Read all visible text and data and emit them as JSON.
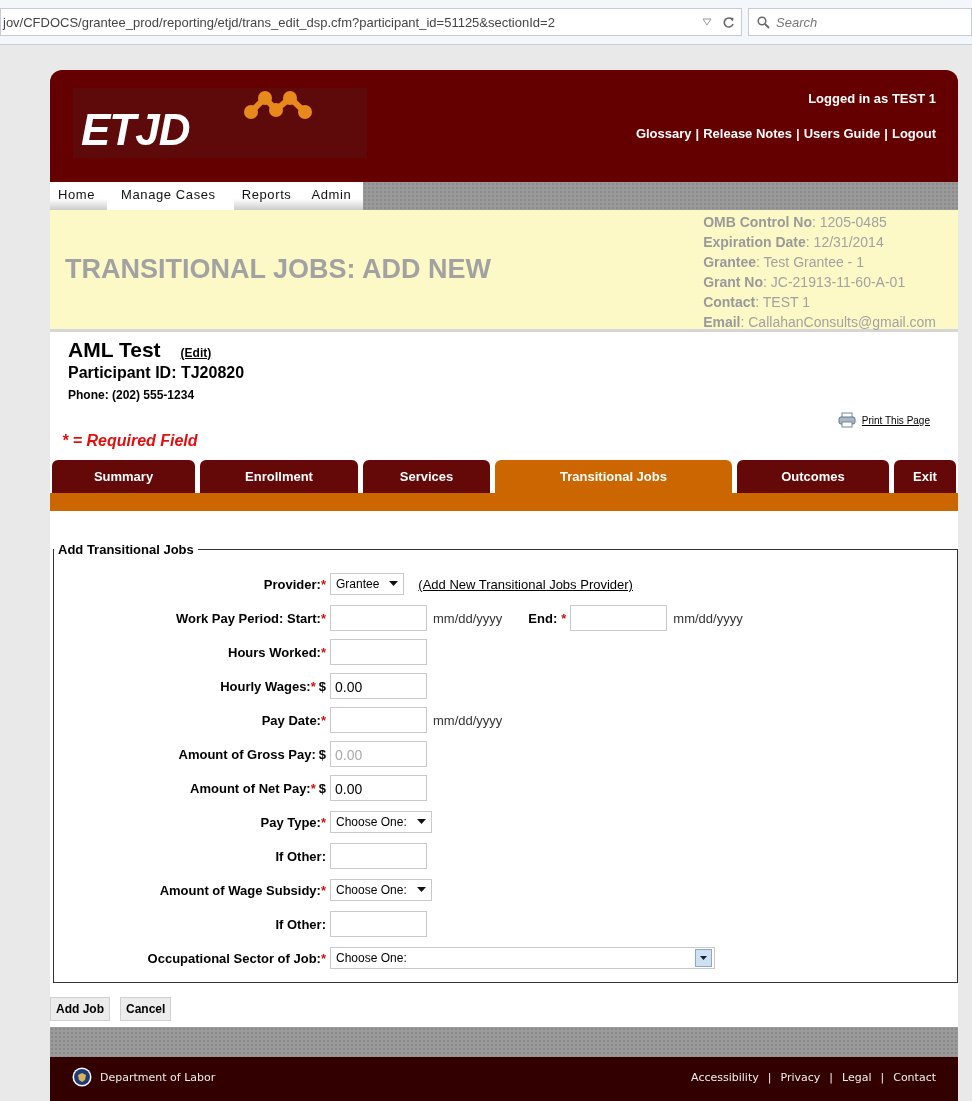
{
  "browser": {
    "url": "jov/CFDOCS/grantee_prod/reporting/etjd/trans_edit_dsp.cfm?participant_id=51125&sectionId=2",
    "search_placeholder": "Search"
  },
  "header": {
    "logo": "ETJD",
    "logged_in": "Logged in as TEST 1",
    "links": [
      "Glossary",
      "Release Notes",
      "Users Guide",
      "Logout"
    ],
    "separator": "|"
  },
  "nav": [
    {
      "label": "Home",
      "selected": false
    },
    {
      "label": "Manage Cases",
      "selected": true
    },
    {
      "label": "Reports",
      "selected": false
    },
    {
      "label": "Admin",
      "selected": false
    }
  ],
  "banner": {
    "title": "TRANSITIONAL JOBS: ADD NEW",
    "info": [
      {
        "label": "OMB Control No",
        "value": ": 1205-0485"
      },
      {
        "label": "Expiration Date",
        "value": ": 12/31/2014"
      },
      {
        "label": "Grantee",
        "value": ": Test Grantee - 1"
      },
      {
        "label": "Grant No",
        "value": ": JC-21913-11-60-A-01"
      },
      {
        "label": "Contact",
        "value": ": TEST 1"
      },
      {
        "label": "Email",
        "value": ": CallahanConsults@gmail.com"
      }
    ]
  },
  "participant": {
    "name": "AML Test",
    "edit": "(Edit)",
    "id": "Participant ID: TJ20820",
    "phone": "Phone: (202) 555-1234",
    "print": "Print This Page",
    "required_note": "* = Required Field"
  },
  "tabs": [
    {
      "label": "Summary",
      "selected": false
    },
    {
      "label": "Enrollment",
      "selected": false
    },
    {
      "label": "Services",
      "selected": false
    },
    {
      "label": "Transitional Jobs",
      "selected": true
    },
    {
      "label": "Outcomes",
      "selected": false
    },
    {
      "label": "Exit",
      "selected": false
    }
  ],
  "form": {
    "legend": "Add Transitional Jobs",
    "required_mark": "*",
    "rows": [
      {
        "label": "Provider:",
        "required": true,
        "control": {
          "kind": "select",
          "value": "Grantee"
        },
        "link": "(Add New Transitional Jobs Provider)"
      },
      {
        "label": "Work Pay Period: Start:",
        "required": true,
        "control": {
          "kind": "input"
        },
        "hint": "mm/dd/yyyy",
        "second": {
          "label": "End:",
          "required": true,
          "hint": "mm/dd/yyyy"
        }
      },
      {
        "label": "Hours Worked:",
        "required": true,
        "control": {
          "kind": "input"
        }
      },
      {
        "label": "Hourly Wages:",
        "required": true,
        "currency": "$",
        "control": {
          "kind": "input",
          "value": "0.00",
          "disabled": false
        }
      },
      {
        "label": "Pay Date:",
        "required": true,
        "control": {
          "kind": "input"
        },
        "hint": "mm/dd/yyyy"
      },
      {
        "label": "Amount of Gross Pay:",
        "required": false,
        "currency": "$",
        "control": {
          "kind": "input",
          "value": "0.00",
          "disabled": true
        }
      },
      {
        "label": "Amount of Net Pay:",
        "required": true,
        "currency": "$",
        "control": {
          "kind": "input",
          "value": "0.00",
          "disabled": false
        }
      },
      {
        "label": "Pay Type:",
        "required": true,
        "control": {
          "kind": "select",
          "value": "Choose One:"
        }
      },
      {
        "label": "If Other:",
        "required": false,
        "control": {
          "kind": "input"
        }
      },
      {
        "label": "Amount of Wage Subsidy:",
        "required": true,
        "control": {
          "kind": "select",
          "value": "Choose One:"
        }
      },
      {
        "label": "If Other:",
        "required": false,
        "control": {
          "kind": "input"
        }
      },
      {
        "label": "Occupational Sector of Job:",
        "required": true,
        "control": {
          "kind": "wide_select",
          "value": "Choose One:"
        }
      }
    ]
  },
  "buttons": [
    "Add Job",
    "Cancel"
  ],
  "footer": {
    "agency": "Department of Labor",
    "links": [
      "Accessibility",
      "Privacy",
      "Legal",
      "Contact"
    ],
    "separator": "|"
  }
}
